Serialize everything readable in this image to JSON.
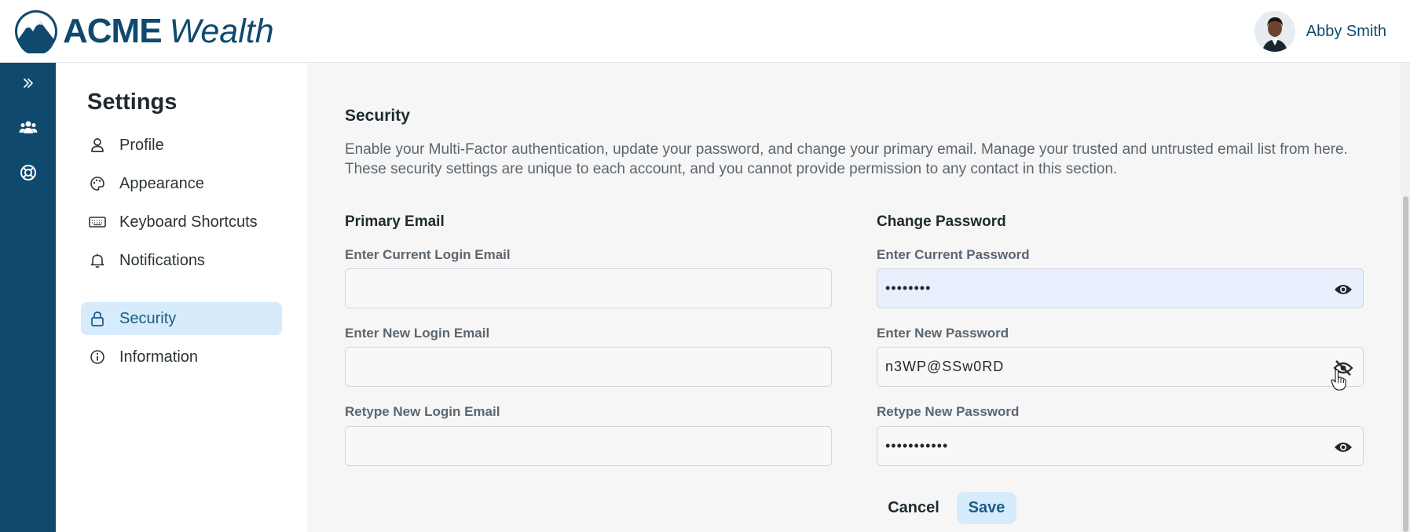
{
  "header": {
    "brand_primary": "ACME",
    "brand_secondary": "Wealth",
    "user_name": "Abby Smith"
  },
  "rail": {
    "items": [
      {
        "icon": "double-chevron-right-icon"
      },
      {
        "icon": "users-icon"
      },
      {
        "icon": "lifebuoy-icon"
      }
    ]
  },
  "settings": {
    "title": "Settings",
    "nav": [
      {
        "label": "Profile",
        "icon": "person-icon"
      },
      {
        "label": "Appearance",
        "icon": "palette-icon"
      },
      {
        "label": "Keyboard Shortcuts",
        "icon": "keyboard-icon"
      },
      {
        "label": "Notifications",
        "icon": "bell-icon"
      },
      {
        "label": "Security",
        "icon": "lock-icon",
        "active": true
      },
      {
        "label": "Information",
        "icon": "info-icon"
      }
    ]
  },
  "security": {
    "title": "Security",
    "description": "Enable your Multi-Factor authentication, update your password, and change your primary email. Manage your trusted and untrusted email list from here. These security settings are unique to each account, and you cannot provide permission to any contact in this section.",
    "primary_email": {
      "heading": "Primary Email",
      "current_label": "Enter Current Login Email",
      "current_value": "",
      "new_label": "Enter New Login Email",
      "new_value": "",
      "retype_label": "Retype New Login Email",
      "retype_value": ""
    },
    "change_password": {
      "heading": "Change Password",
      "current_label": "Enter Current Password",
      "current_value": "••••••••",
      "new_label": "Enter New Password",
      "new_value": "n3WP@SSw0RD",
      "retype_label": "Retype New Password",
      "retype_value": "•••••••••••"
    },
    "cancel_label": "Cancel",
    "save_label": "Save"
  },
  "colors": {
    "brand": "#0f4a6e",
    "active_bg": "#d6ebfb",
    "active_text": "#1a5c86",
    "autofill_bg": "#e8f0fe"
  }
}
